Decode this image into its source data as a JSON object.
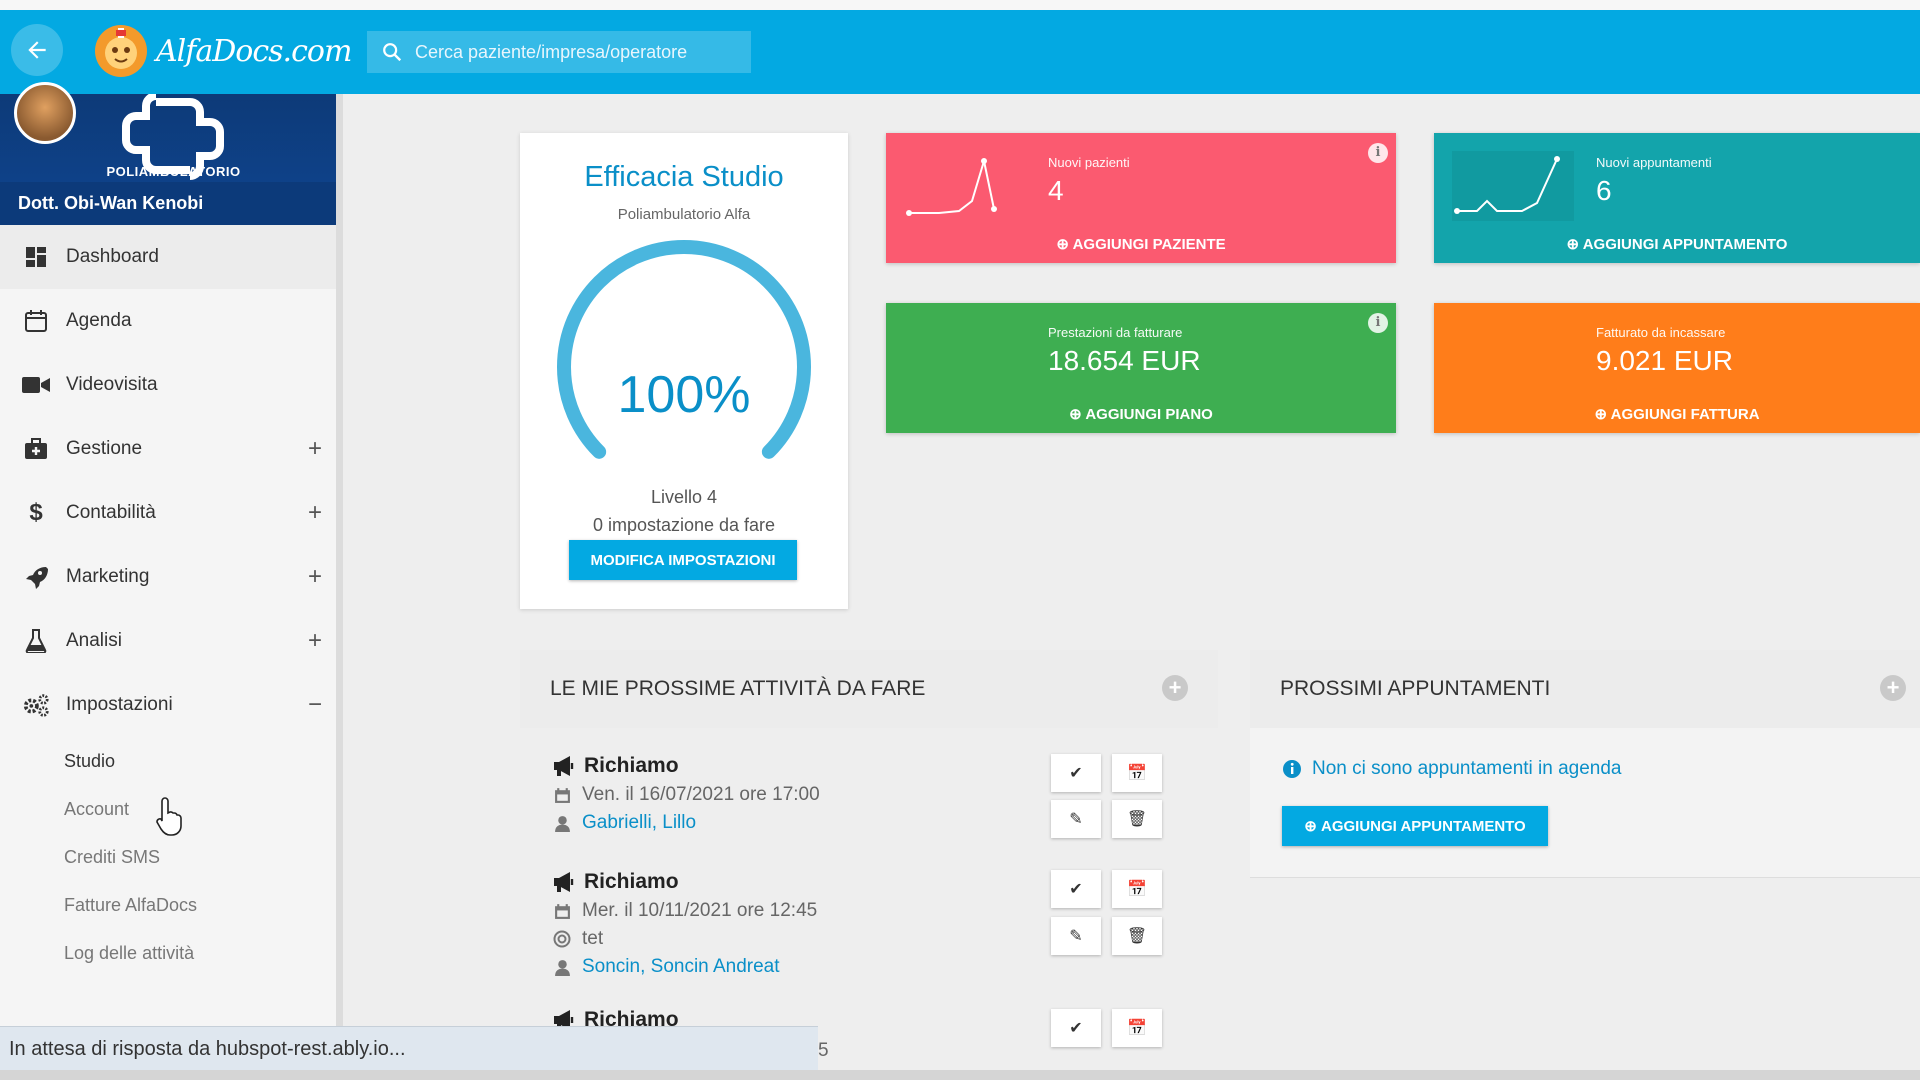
{
  "topbar": {
    "logo_text": "AlfaDocs.com",
    "search_placeholder": "Cerca paziente/impresa/operatore"
  },
  "profile": {
    "clinic_name": "POLIAMBULATORIO",
    "doctor_name": "Dott. Obi-Wan Kenobi"
  },
  "sidebar": {
    "items": [
      {
        "label": "Dashboard",
        "icon": "dashboard-icon",
        "toggle": ""
      },
      {
        "label": "Agenda",
        "icon": "calendar-icon",
        "toggle": ""
      },
      {
        "label": "Videovisita",
        "icon": "video-icon",
        "toggle": ""
      },
      {
        "label": "Gestione",
        "icon": "medkit-icon",
        "toggle": "+"
      },
      {
        "label": "Contabilità",
        "icon": "dollar-icon",
        "toggle": "+"
      },
      {
        "label": "Marketing",
        "icon": "rocket-icon",
        "toggle": "+"
      },
      {
        "label": "Analisi",
        "icon": "flask-icon",
        "toggle": "+"
      },
      {
        "label": "Impostazioni",
        "icon": "gears-icon",
        "toggle": "−"
      }
    ],
    "subitems": [
      "Studio",
      "Account",
      "Crediti SMS",
      "Fatture AlfaDocs",
      "Log delle attività"
    ]
  },
  "efficacia": {
    "title": "Efficacia Studio",
    "subtitle": "Poliambulatorio Alfa",
    "percent": "100%",
    "percent_value": 100,
    "level": "Livello 4",
    "todo": "0 impostazione da fare",
    "button": "MODIFICA IMPOSTAZIONI"
  },
  "tiles": {
    "pazienti": {
      "label": "Nuovi pazienti",
      "value": "4",
      "action": "AGGIUNGI PAZIENTE",
      "color": "#fb5a70"
    },
    "appuntamenti": {
      "label": "Nuovi appuntamenti",
      "value": "6",
      "action": "AGGIUNGI APPUNTAMENTO",
      "color": "#13a4ab"
    },
    "prestazioni": {
      "label": "Prestazioni da fatturare",
      "value": "18.654 EUR",
      "action": "AGGIUNGI PIANO",
      "color": "#3eae51"
    },
    "fatturato": {
      "label": "Fatturato da incassare",
      "value": "9.021 EUR",
      "action": "AGGIUNGI FATTURA",
      "color": "#ff7d1a"
    }
  },
  "tasks_panel": {
    "title": "LE MIE PROSSIME ATTIVITÀ DA FARE",
    "tasks": [
      {
        "title": "Richiamo",
        "date": "Ven. il 16/07/2021 ore 17:00",
        "note": "",
        "person": "Gabrielli, Lillo"
      },
      {
        "title": "Richiamo",
        "date": "Mer. il 10/11/2021 ore 12:45",
        "note": "tet",
        "person": "Soncin, Soncin Andreat"
      },
      {
        "title": "Richiamo",
        "date": "",
        "note": "",
        "person": ""
      }
    ],
    "partial_digit": "5"
  },
  "appointments_panel": {
    "title": "PROSSIMI APPUNTAMENTI",
    "empty_text": "Non ci sono appuntamenti in agenda",
    "button": "AGGIUNGI APPUNTAMENTO"
  },
  "statusbar": {
    "text": "In attesa di risposta da hubspot-rest.ably.io..."
  },
  "colors": {
    "topbar": "#03a9e2",
    "accent": "#0a8fc8",
    "profile": "#0e4590"
  }
}
